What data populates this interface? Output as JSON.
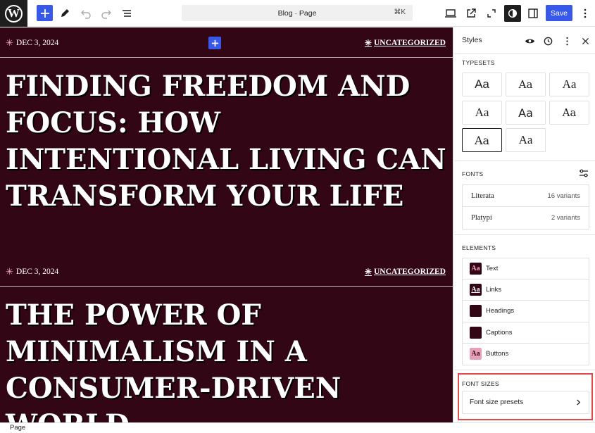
{
  "toolbar": {
    "document_title": "Blog · Page",
    "shortcut": "⌘K",
    "save_label": "Save",
    "accent": "#3858e9"
  },
  "canvas": {
    "background": "#330615",
    "posts": [
      {
        "date": "DEC 3, 2024",
        "category": "UNCATEGORIZED",
        "title": "FINDING FREEDOM AND FOCUS: HOW INTENTIONAL LIVING CAN TRANSFORM YOUR LIFE"
      },
      {
        "date": "DEC 3, 2024",
        "category": "UNCATEGORIZED",
        "title": "THE POWER OF MINIMALISM IN A CONSUMER-DRIVEN WORLD"
      }
    ]
  },
  "sidebar": {
    "title": "Styles",
    "typesets_label": "TYPESETS",
    "typesets": [
      "Aa",
      "Aa",
      "Aa",
      "Aa",
      "Aa",
      "Aa",
      "Aa",
      "Aa"
    ],
    "fonts_label": "FONTS",
    "fonts": [
      {
        "name": "Literata",
        "variants": "16 variants"
      },
      {
        "name": "Platypi",
        "variants": "2 variants"
      }
    ],
    "elements_label": "ELEMENTS",
    "elements": [
      {
        "label": "Text",
        "swatch_text": "Aa",
        "swatch_bg": "#330615",
        "swatch_fg": "#f3a9c2"
      },
      {
        "label": "Links",
        "swatch_text": "Aa",
        "swatch_bg": "#330615",
        "swatch_fg": "#ffffff"
      },
      {
        "label": "Headings",
        "swatch_text": "",
        "swatch_bg": "#330615",
        "swatch_fg": "#ffffff"
      },
      {
        "label": "Captions",
        "swatch_text": "",
        "swatch_bg": "#330615",
        "swatch_fg": "#ffffff"
      },
      {
        "label": "Buttons",
        "swatch_text": "Aa",
        "swatch_bg": "#e8a0b8",
        "swatch_fg": "#330615"
      }
    ],
    "font_sizes_label": "FONT SIZES",
    "font_size_presets_label": "Font size presets"
  },
  "statusbar": {
    "label": "Page"
  }
}
